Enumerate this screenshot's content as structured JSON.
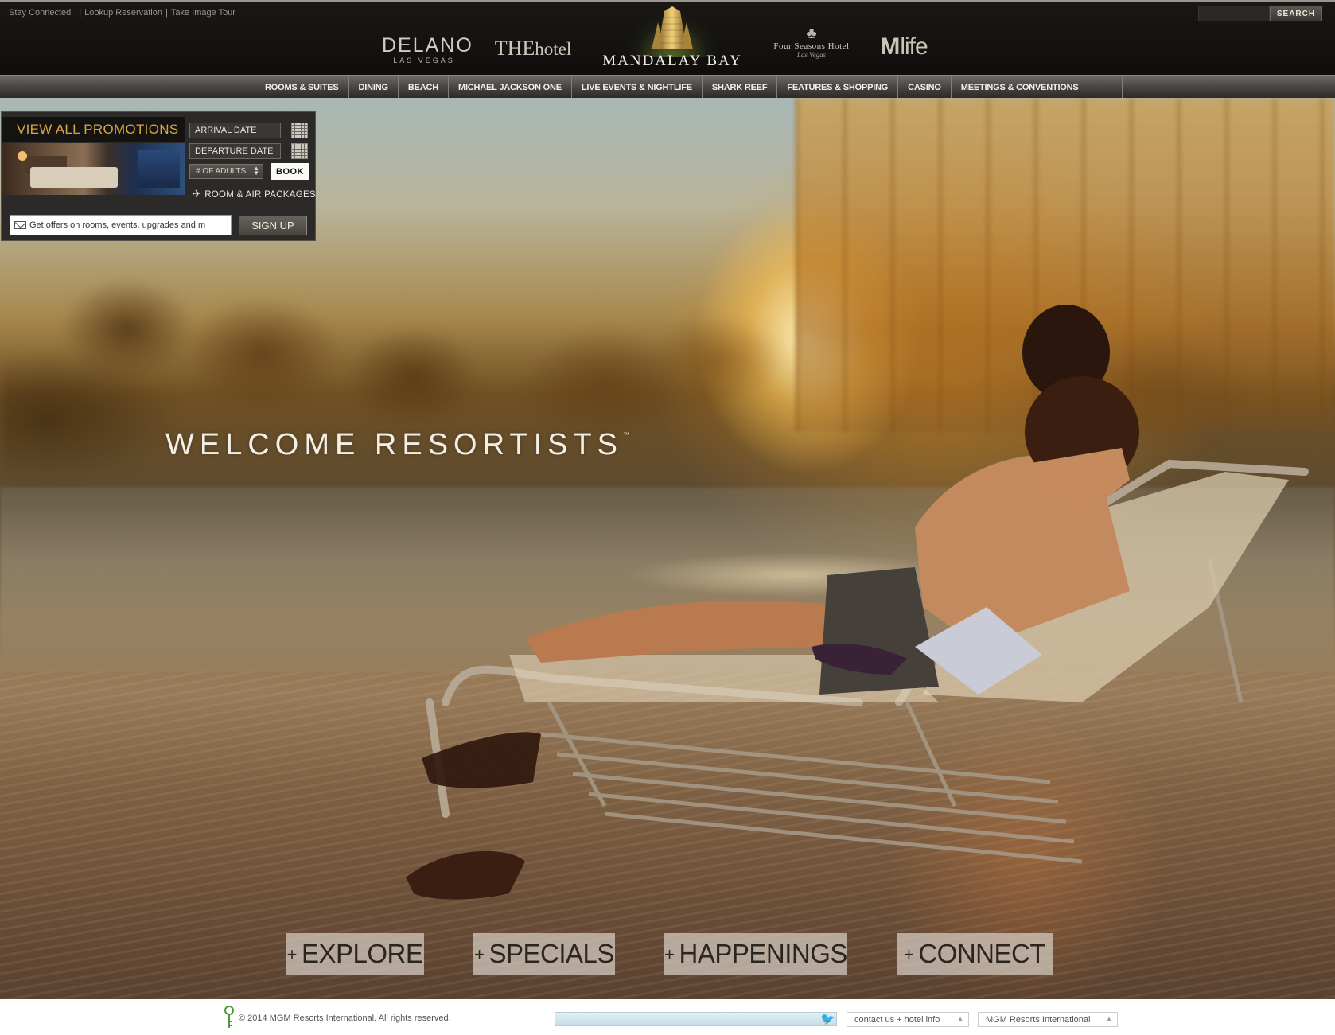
{
  "topbar": {
    "links": [
      "Stay Connected",
      "Lookup Reservation",
      "Take Image Tour"
    ],
    "search_button": "SEARCH"
  },
  "brands": {
    "delano": {
      "name": "DELANO",
      "sub": "LAS VEGAS"
    },
    "thehotel": {
      "bold": "THE",
      "thin": "hotel"
    },
    "mandalay": {
      "name": "MANDALAY BAY"
    },
    "fourseasons": {
      "name": "Four Seasons Hotel",
      "script": "Las Vegas"
    },
    "mlife": {
      "bold": "M",
      "thin": "life"
    }
  },
  "nav": {
    "items": [
      "ROOMS & SUITES",
      "DINING",
      "BEACH",
      "MICHAEL JACKSON ONE",
      "LIVE EVENTS & NIGHTLIFE",
      "SHARK REEF",
      "FEATURES & SHOPPING",
      "CASINO",
      "MEETINGS & CONVENTIONS"
    ]
  },
  "booking": {
    "promo_label": "VIEW ALL PROMOTIONS",
    "arrival_placeholder": "ARRIVAL DATE",
    "departure_placeholder": "DEPARTURE DATE",
    "adults_label": "# OF ADULTS",
    "book_label": "BOOK",
    "packages_label": "ROOM & AIR PACKAGES",
    "signup_placeholder": "Get offers on rooms, events, upgrades and m",
    "signup_label": "SIGN UP"
  },
  "hero": {
    "welcome": "WELCOME RESORTISTS",
    "tm": "™",
    "buttons": [
      "EXPLORE",
      "SPECIALS",
      "HAPPENINGS",
      "CONNECT"
    ],
    "plus": "+"
  },
  "footer": {
    "copyright": "© 2014 MGM Resorts International. All rights reserved.",
    "contact": "contact us + hotel info",
    "mgm": "MGM Resorts International"
  },
  "icons": {
    "calendar": "calendar-icon",
    "plane": "plane-icon",
    "envelope": "envelope-icon",
    "twitter": "twitter-icon",
    "key": "key-icon"
  },
  "colors": {
    "promo_gold": "#d9a542",
    "topbar": "#141311",
    "nav": "#4b4946"
  }
}
